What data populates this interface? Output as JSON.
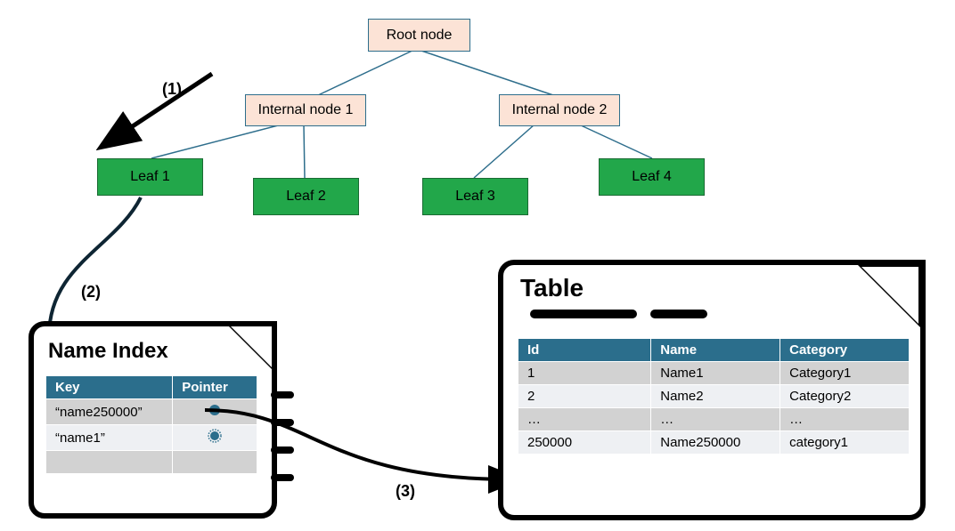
{
  "tree": {
    "root": "Root node",
    "internal1": "Internal node 1",
    "internal2": "Internal node 2",
    "leaf1": "Leaf 1",
    "leaf2": "Leaf 2",
    "leaf3": "Leaf 3",
    "leaf4": "Leaf 4"
  },
  "steps": {
    "s1": "(1)",
    "s2": "(2)",
    "s3": "(3)"
  },
  "index_card": {
    "title": "Name Index",
    "headers": {
      "key": "Key",
      "pointer": "Pointer"
    },
    "rows": [
      {
        "key": "“name250000”",
        "pointer_icon": "circle-solid"
      },
      {
        "key": "“name1”",
        "pointer_icon": "circle-spiky"
      },
      {
        "key": "",
        "pointer_icon": ""
      }
    ]
  },
  "table_card": {
    "title": "Table",
    "headers": {
      "id": "Id",
      "name": "Name",
      "category": "Category"
    },
    "rows": [
      {
        "id": "1",
        "name": "Name1",
        "category": "Category1"
      },
      {
        "id": "2",
        "name": "Name2",
        "category": "Category2"
      },
      {
        "id": "…",
        "name": "…",
        "category": "…"
      },
      {
        "id": "250000",
        "name": "Name250000",
        "category": "category1"
      }
    ]
  },
  "colors": {
    "leaf_fill": "#22a74a",
    "node_fill": "#fce3d6",
    "table_header": "#2b6e8c",
    "edge": "#2e6e8c"
  }
}
